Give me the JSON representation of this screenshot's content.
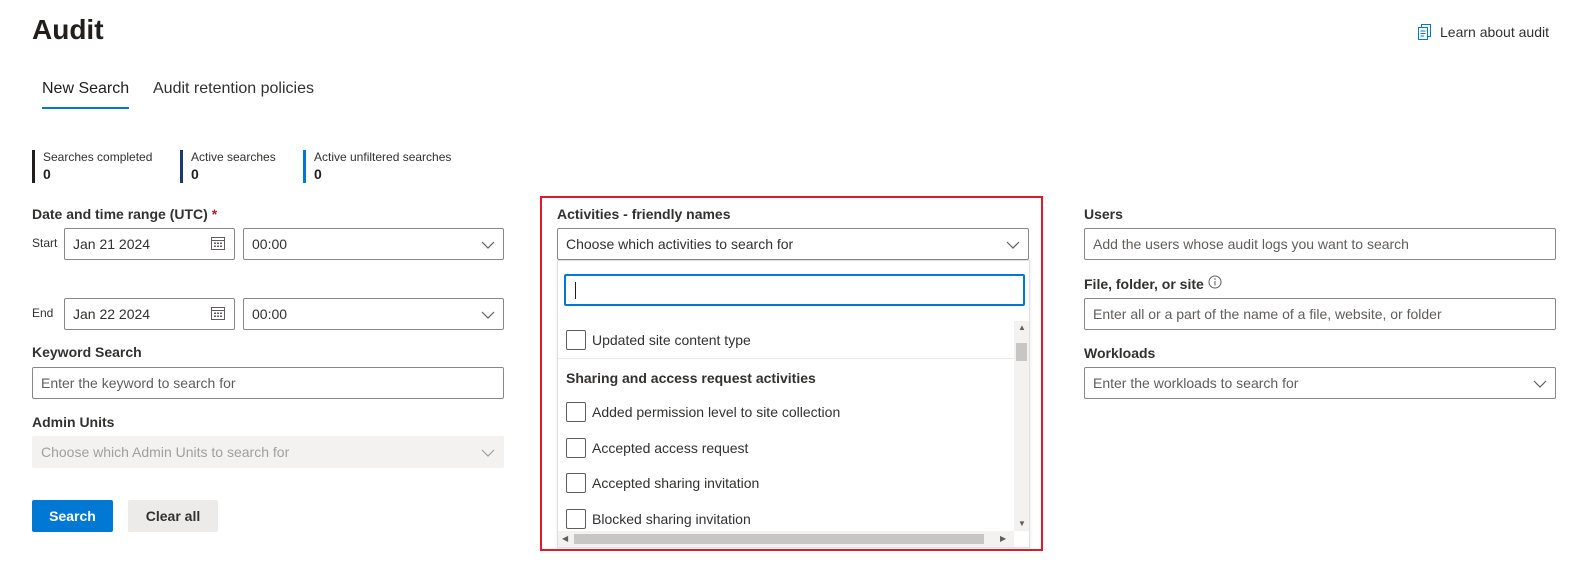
{
  "header": {
    "title": "Audit",
    "learn_link": "Learn about audit",
    "learn_icon": "document-copy-icon"
  },
  "tabs": [
    {
      "label": "New Search",
      "active": true
    },
    {
      "label": "Audit retention policies",
      "active": false
    }
  ],
  "stats": [
    {
      "label": "Searches completed",
      "value": "0",
      "color": "#201f1e"
    },
    {
      "label": "Active searches",
      "value": "0",
      "color": "#1b3a6b"
    },
    {
      "label": "Active unfiltered searches",
      "value": "0",
      "color": "#0078d4"
    }
  ],
  "date_range": {
    "label": "Date and time range (UTC)",
    "required_mark": "*",
    "start_label": "Start",
    "start_date": "Jan 21 2024",
    "start_time": "00:00",
    "end_label": "End",
    "end_date": "Jan 22 2024",
    "end_time": "00:00"
  },
  "keyword": {
    "label": "Keyword Search",
    "placeholder": "Enter the keyword to search for"
  },
  "admin_units": {
    "label": "Admin Units",
    "placeholder": "Choose which Admin Units to search for"
  },
  "buttons": {
    "search": "Search",
    "clear": "Clear all"
  },
  "activities": {
    "label": "Activities - friendly names",
    "placeholder": "Choose which activities to search for",
    "filter_value": "",
    "items": {
      "updated_site_content_type": "Updated site content type",
      "group_sharing": "Sharing and access request activities",
      "added_permission_level": "Added permission level to site collection",
      "accepted_access_request": "Accepted access request",
      "accepted_sharing_invitation": "Accepted sharing invitation",
      "blocked_sharing_invitation": "Blocked sharing invitation"
    }
  },
  "users": {
    "label": "Users",
    "placeholder": "Add the users whose audit logs you want to search"
  },
  "file_folder_site": {
    "label": "File, folder, or site",
    "placeholder": "Enter all or a part of the name of a file, website, or folder"
  },
  "workloads": {
    "label": "Workloads",
    "placeholder": "Enter the workloads to search for"
  },
  "colors": {
    "accent": "#0078d4",
    "highlight": "#e01a2a"
  }
}
